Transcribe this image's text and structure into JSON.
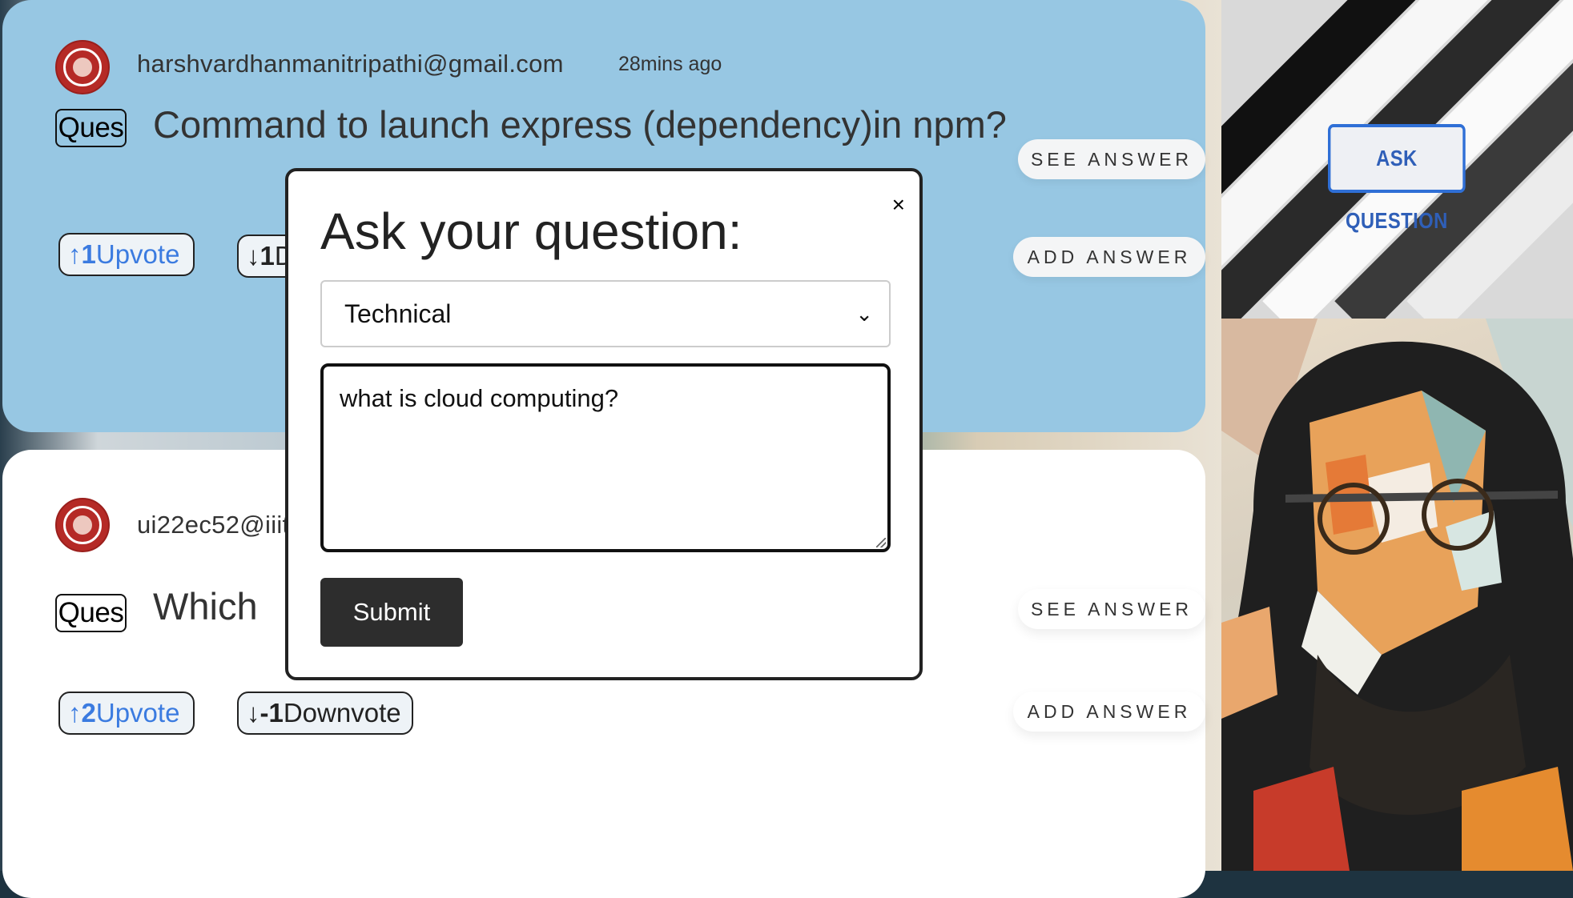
{
  "feed": {
    "posts": [
      {
        "email": "harshvardhanmanitripathi@gmail.com",
        "time": "28mins ago",
        "tag": "Ques",
        "question": "Command to launch express (dependency)in npm?",
        "upvote_count": "1",
        "upvote_label": "Upvote",
        "downvote_count": "1",
        "downvote_label": "D",
        "see_answer": "SEE ANSWER",
        "add_answer": "ADD ANSWER"
      },
      {
        "email": "ui22ec52@iiit",
        "time": "",
        "tag": "Ques",
        "question": "Which",
        "upvote_count": "2",
        "upvote_label": "Upvote",
        "downvote_count": "-1",
        "downvote_label": "Downvote",
        "see_answer": "SEE ANSWER",
        "add_answer": "ADD ANSWER"
      }
    ]
  },
  "sidebar": {
    "ask_button": "ASK QUESTION"
  },
  "modal": {
    "title": "Ask your question:",
    "close": "×",
    "category_selected": "Technical",
    "question_value": "what is cloud computing?",
    "submit": "Submit"
  },
  "colors": {
    "card_blue": "#97c7e3",
    "accent": "#3b7be0"
  },
  "icons": [
    "brain-logo-icon",
    "arrow-up-icon",
    "arrow-down-icon",
    "close-icon",
    "chevron-down-icon"
  ]
}
